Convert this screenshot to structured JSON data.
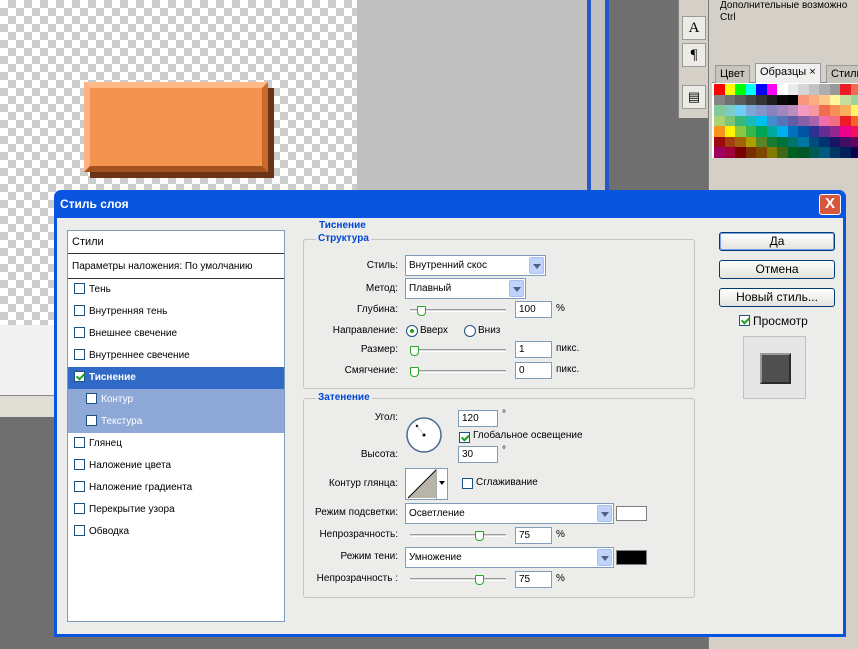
{
  "right_panel": {
    "text_lines": [
      "Дополнительные возможно",
      "Ctrl"
    ],
    "tabs": [
      {
        "label": "Цвет"
      },
      {
        "label": "Образцы"
      },
      {
        "label": "Стили"
      }
    ],
    "tab_close": "×",
    "swatch_colors": [
      [
        "#ff0000",
        "#ffff00",
        "#00ff00",
        "#00ffff",
        "#0000ff",
        "#ff00ff",
        "#ffffff",
        "#ebebeb",
        "#d6d6d6",
        "#c2c2c2",
        "#adadad",
        "#999999",
        "#ed1c24",
        "#f26c4f"
      ],
      [
        "#858585",
        "#707070",
        "#5c5c5c",
        "#474747",
        "#333333",
        "#1f1f1f",
        "#0a0a0a",
        "#000000",
        "#f7977a",
        "#f9ad81",
        "#fdc68a",
        "#fff79a",
        "#c4df9b",
        "#a3d39c"
      ],
      [
        "#82ca9c",
        "#7accc8",
        "#6dcff6",
        "#7ea7d8",
        "#8493ca",
        "#8882be",
        "#a187be",
        "#bc8dbf",
        "#f49ac2",
        "#f6989d",
        "#f26c4f",
        "#f68e56",
        "#fbaf5d",
        "#fff568"
      ],
      [
        "#acd373",
        "#7cc576",
        "#3bb878",
        "#1abbb4",
        "#00bff3",
        "#448ccb",
        "#5674b9",
        "#605ca8",
        "#855fa8",
        "#a864a8",
        "#f06eaa",
        "#f26d7d",
        "#ed1c24",
        "#f26522"
      ],
      [
        "#f7941d",
        "#fff200",
        "#8dc63f",
        "#39b54a",
        "#00a651",
        "#00a99d",
        "#00aeef",
        "#0072bc",
        "#0054a6",
        "#2e3192",
        "#662d91",
        "#92278f",
        "#ec008c",
        "#ed145b"
      ],
      [
        "#9e0b0f",
        "#a0410d",
        "#a3620a",
        "#aba000",
        "#598527",
        "#197b30",
        "#007236",
        "#00746b",
        "#0076a3",
        "#004a80",
        "#003471",
        "#1b1464",
        "#440e62",
        "#630460"
      ],
      [
        "#9e005d",
        "#9e0039",
        "#790000",
        "#7b2e00",
        "#7d4900",
        "#827b00",
        "#406618",
        "#005e20",
        "#005826",
        "#005952",
        "#005b7f",
        "#003663",
        "#002157",
        "#0d004c"
      ]
    ]
  },
  "tools": {
    "text_icon": "A",
    "para_icon": "¶",
    "panel_icon": "▤"
  },
  "dialog": {
    "title": "Стиль слоя",
    "close": "X",
    "styles_header": "Стили",
    "blending_options": "Параметры наложения: По умолчанию",
    "style_items": [
      {
        "label": "Тень",
        "checked": false
      },
      {
        "label": "Внутренняя тень",
        "checked": false
      },
      {
        "label": "Внешнее свечение",
        "checked": false
      },
      {
        "label": "Внутреннее свечение",
        "checked": false
      },
      {
        "label": "Тиснение",
        "checked": true
      },
      {
        "label": "Контур",
        "checked": false
      },
      {
        "label": "Текстура",
        "checked": false
      },
      {
        "label": "Глянец",
        "checked": false
      },
      {
        "label": "Наложение цвета",
        "checked": false
      },
      {
        "label": "Наложение градиента",
        "checked": false
      },
      {
        "label": "Перекрытие узора",
        "checked": false
      },
      {
        "label": "Обводка",
        "checked": false
      }
    ],
    "section_title": "Тиснение",
    "structure": {
      "title": "Структура",
      "style_label": "Стиль:",
      "style_value": "Внутренний скос",
      "method_label": "Метод:",
      "method_value": "Плавный",
      "depth_label": "Глубина:",
      "depth_value": "100",
      "depth_unit": "%",
      "depth_level": 0.08,
      "direction_label": "Направление:",
      "dir_up": "Вверх",
      "dir_down": "Вниз",
      "direction": "up",
      "size_label": "Размер:",
      "size_value": "1",
      "size_unit": "пикс.",
      "size_level": 0.0,
      "soften_label": "Смягчение:",
      "soften_value": "0",
      "soften_unit": "пикс.",
      "soften_level": 0.0
    },
    "shading": {
      "title": "Затенение",
      "angle_label": "Угол:",
      "angle_value": "120",
      "angle_unit": "°",
      "global_light": "Глобальное освещение",
      "global_light_checked": true,
      "altitude_label": "Высота:",
      "altitude_value": "30",
      "altitude_unit": "°",
      "gloss_label": "Контур глянца:",
      "antialias": "Сглаживание",
      "antialias_checked": false,
      "highlight_label": "Режим подсветки:",
      "highlight_value": "Осветление",
      "highlight_color": "#ffffff",
      "opacity1_label": "Непрозрачность:",
      "opacity1_value": "75",
      "opacity1_unit": "%",
      "opacity1_level": 0.75,
      "shadow_label": "Режим тени:",
      "shadow_value": "Умножение",
      "shadow_color": "#000000",
      "opacity2_label": "Непрозрачность :",
      "opacity2_value": "75",
      "opacity2_unit": "%",
      "opacity2_level": 0.75
    },
    "buttons": {
      "ok": "Да",
      "cancel": "Отмена",
      "new_style": "Новый стиль...",
      "preview": "Просмотр",
      "preview_checked": true
    }
  },
  "colors": {
    "accent": "#0a55e0",
    "selection": "#3169c6",
    "subitem": "#8ea9d8",
    "orange": "#f4924f"
  }
}
